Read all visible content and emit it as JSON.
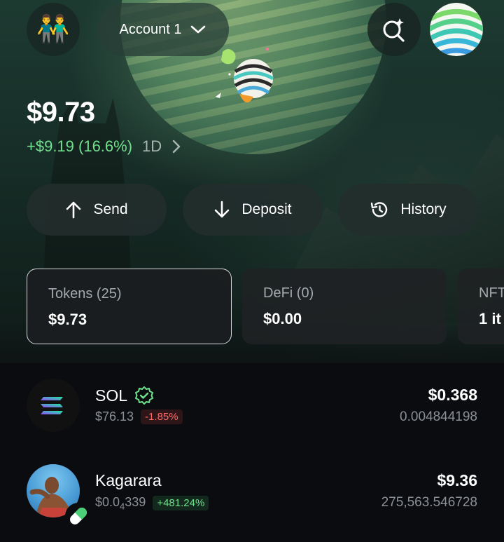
{
  "header": {
    "account_label": "Account 1",
    "avatar_emoji": "👬"
  },
  "balance": {
    "total": "$9.73",
    "change": "+$9.19 (16.6%)",
    "period": "1D"
  },
  "actions": [
    {
      "label": "Send",
      "icon": "arrow-up-icon"
    },
    {
      "label": "Deposit",
      "icon": "arrow-down-icon"
    },
    {
      "label": "History",
      "icon": "history-icon"
    }
  ],
  "tabs": [
    {
      "label": "Tokens (25)",
      "value": "$9.73",
      "active": true
    },
    {
      "label": "DeFi (0)",
      "value": "$0.00",
      "active": false
    },
    {
      "label": "NFT",
      "value": "1 it",
      "active": false
    }
  ],
  "tokens": [
    {
      "name": "SOL",
      "verified": true,
      "price": "$76.13",
      "change": "-1.85%",
      "value": "$0.368",
      "amount": "0.004844198"
    },
    {
      "name": "Kagarara",
      "verified": false,
      "price_main": "$0.0",
      "price_sub": "4",
      "price_tail": "339",
      "change": "+481.24%",
      "value": "$9.36",
      "amount": "275,563.546728"
    }
  ],
  "colors": {
    "accent_green": "#6fe08c",
    "negative_red": "#ff6b6b"
  }
}
